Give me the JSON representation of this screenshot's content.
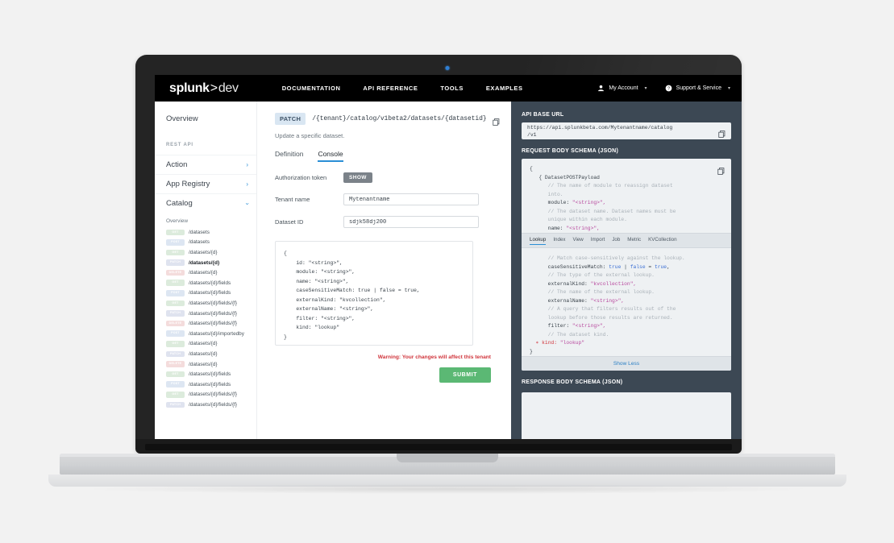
{
  "topnav": {
    "logo_main": "splunk",
    "logo_gt": ">",
    "logo_dev": "dev",
    "items": [
      {
        "label": "DOCUMENTATION",
        "active": false
      },
      {
        "label": "API REFERENCE",
        "active": true
      },
      {
        "label": "TOOLS",
        "active": false
      },
      {
        "label": "EXAMPLES",
        "active": false
      }
    ],
    "right": [
      {
        "label": "My Account",
        "icon": "person-icon",
        "caret": "▾"
      },
      {
        "label": "Support & Service",
        "icon": "help-icon",
        "caret": "▾"
      }
    ]
  },
  "sidebar": {
    "overview": "Overview",
    "section_label": "REST API",
    "groups": [
      {
        "label": "Action",
        "chev": "›",
        "expanded": false
      },
      {
        "label": "App Registry",
        "chev": "›",
        "expanded": false
      },
      {
        "label": "Catalog",
        "chev": "›",
        "expanded": true
      }
    ],
    "sub_title": "Overview",
    "endpoints": [
      {
        "method": "GET",
        "path": "/datasets",
        "active": false
      },
      {
        "method": "POST",
        "path": "/datasets",
        "active": false
      },
      {
        "method": "GET",
        "path": "/datasets/{d}",
        "active": false
      },
      {
        "method": "PATCH",
        "path": "/datasets/{d}",
        "active": true
      },
      {
        "method": "DELETE",
        "path": "/datasets/{d}",
        "active": false
      },
      {
        "method": "GET",
        "path": "/datasets/{d}/fields",
        "active": false
      },
      {
        "method": "POST",
        "path": "/datasets/{d}/fields",
        "active": false
      },
      {
        "method": "GET",
        "path": "/datasets/{d}/fields/{f}",
        "active": false
      },
      {
        "method": "PATCH",
        "path": "/datasets/{d}/fields/{f}",
        "active": false
      },
      {
        "method": "DELETE",
        "path": "/datasets/{d}/fields/{f}",
        "active": false
      },
      {
        "method": "POST",
        "path": "/datasets/{d}/importedby",
        "active": false
      },
      {
        "method": "GET",
        "path": "/datasets/{d}",
        "active": false
      },
      {
        "method": "PATCH",
        "path": "/datasets/{d}",
        "active": false
      },
      {
        "method": "DELETE",
        "path": "/datasets/{d}",
        "active": false
      },
      {
        "method": "GET",
        "path": "/datasets/{d}/fields",
        "active": false
      },
      {
        "method": "POST",
        "path": "/datasets/{d}/fields",
        "active": false
      },
      {
        "method": "GET",
        "path": "/datasets/{d}/fields/{f}",
        "active": false
      },
      {
        "method": "PATCH",
        "path": "/datasets/{d}/fields/{f}",
        "active": false
      }
    ]
  },
  "center": {
    "method": "PATCH",
    "url": "/{tenant}/catalog/v1beta2/datasets/{datasetid}",
    "description": "Update a specific dataset.",
    "tabs": [
      {
        "label": "Definition",
        "active": false
      },
      {
        "label": "Console",
        "active": true
      }
    ],
    "form": {
      "auth_label": "Authorization token",
      "show_button": "SHOW",
      "tenant_label": "Tenant name",
      "tenant_value": "Mytenantname",
      "dataset_label": "Dataset ID",
      "dataset_value": "sdjk58dj200"
    },
    "editor_code": "{\n    id: \"<string>\",\n    module: \"<string>\",\n    name: \"<string>\",\n    caseSensitiveMatch: true | false = true,\n    externalKind: \"kvcollection\",\n    externalName: \"<string>\",\n    filter: \"<string>\",\n    kind: \"lookup\"\n}",
    "warning": "Warning: Your changes will affect this tenant",
    "submit_label": "SUBMIT"
  },
  "right": {
    "base_url_label": "API BASE URL",
    "base_url_line1": "https://api.splunkbeta.com/Mytenantname/catalog",
    "base_url_line2": "/v1",
    "request_label": "REQUEST BODY SCHEMA (JSON)",
    "kind_tabs": [
      {
        "label": "Lookup",
        "active": true
      },
      {
        "label": "Index",
        "active": false
      },
      {
        "label": "View",
        "active": false
      },
      {
        "label": "Import",
        "active": false
      },
      {
        "label": "Job",
        "active": false
      },
      {
        "label": "Metric",
        "active": false
      },
      {
        "label": "KVCollection",
        "active": false
      }
    ],
    "show_less": "Show Less",
    "response_label": "RESPONSE BODY SCHEMA (JSON)",
    "schema_top": [
      {
        "t": "plain",
        "v": "{"
      },
      {
        "t": "plain",
        "v": "   { DatasetPOSTPayload"
      },
      {
        "t": "cmt",
        "v": "      // The name of module to reassign dataset"
      },
      {
        "t": "cmt",
        "v": "      into."
      },
      {
        "t": "kv",
        "k": "      module: ",
        "s": "\"<string>\","
      },
      {
        "t": "cmt",
        "v": "      // The dataset name. Dataset names must be"
      },
      {
        "t": "cmt",
        "v": "      unique within each module."
      },
      {
        "t": "kv",
        "k": "      name: ",
        "s": "\"<string>\","
      }
    ],
    "schema_bottom": [
      {
        "t": "cmt",
        "v": "      // Match case-sensitively against the lookup."
      },
      {
        "t": "bool",
        "k": "      caseSensitiveMatch: ",
        "b1": "true",
        "sep": " | ",
        "b2": "false",
        "eq": " = ",
        "b3": "true",
        "tail": ","
      },
      {
        "t": "cmt",
        "v": "      // The type of the external lookup."
      },
      {
        "t": "kv",
        "k": "      externalKind: ",
        "s": "\"kvcollection\","
      },
      {
        "t": "cmt",
        "v": "      // The name of the external lookup."
      },
      {
        "t": "kv",
        "k": "      externalName: ",
        "s": "\"<string>\","
      },
      {
        "t": "cmt",
        "v": "      // A query that filters results out of the"
      },
      {
        "t": "cmt",
        "v": "      lookup before those results are returned."
      },
      {
        "t": "kv",
        "k": "      filter: ",
        "s": "\"<string>\","
      },
      {
        "t": "cmt",
        "v": "      // The dataset kind."
      },
      {
        "t": "req",
        "star": "  ∗ ",
        "k": "kind: ",
        "s": "\"lookup\""
      },
      {
        "t": "plain",
        "v": "}"
      }
    ]
  },
  "colors": {
    "nav_bg": "#000000",
    "nav_accent": "#65b948",
    "panel_bg": "#3c4854",
    "link_blue": "#2b8fd6",
    "submit_green": "#5bb874",
    "warning_red": "#d0353c"
  }
}
